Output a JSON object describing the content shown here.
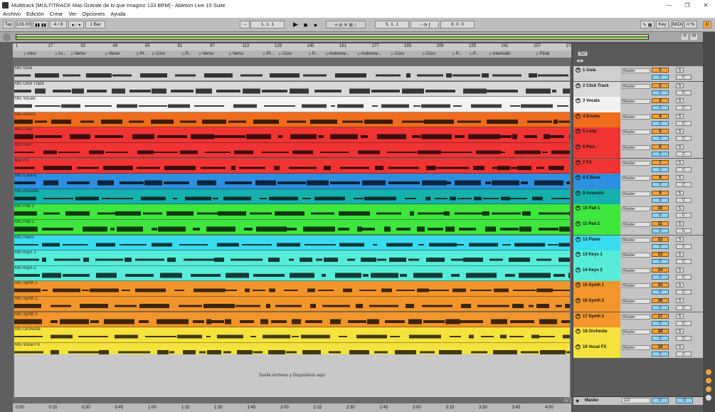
{
  "window": {
    "title": "Multitrack  [MULTITRACK Mas Grande de lo que Imagino 133 BPM]  - Ableton Live 10 Suite",
    "controls": [
      "—",
      "❐",
      "✕"
    ]
  },
  "menu": [
    "Archivo",
    "Edición",
    "Crear",
    "Ver",
    "Opciones",
    "Ayuda"
  ],
  "transport": {
    "tap": "Tap",
    "tempo": "133.00",
    "signature": "4 / 8",
    "metronome": "1 Bar",
    "position": "1.  1.  1",
    "loop_start": "5.  1.  1",
    "loop_length": "8.  0.  0",
    "key": "Key",
    "midi": "MIDI",
    "cpu": "0 %",
    "d": "D"
  },
  "ruler": [
    "1",
    "17",
    "33",
    "49",
    "65",
    "81",
    "97",
    "113",
    "129",
    "145",
    "161",
    "177",
    "193",
    "209",
    "225",
    "241",
    "257",
    "273"
  ],
  "locators": [
    "Intro",
    "In...",
    "Verso",
    "Verso",
    "Pr...",
    "Coro",
    "P...",
    "Verso",
    "Verso",
    "Pr...",
    "Coro",
    "P...",
    "Instrume...",
    "Instrume...",
    "Coro",
    "Coro",
    "P...",
    "P...",
    "Interludio",
    "Final"
  ],
  "set_label": "Set",
  "drop_hint": "Suelte Archivos y Dispositivos aquí",
  "time_axis": [
    "0:00",
    "0:15",
    "0:30",
    "0:45",
    "1:00",
    "1:15",
    "1:30",
    "1:45",
    "2:00",
    "2:15",
    "2:30",
    "2:45",
    "3:00",
    "3:15",
    "3:30",
    "3:45",
    "4:00"
  ],
  "page_indicator": "4/1",
  "tracks": [
    {
      "clip": "MG Guia",
      "name": "1 Guia",
      "num": "1",
      "routing": "Master",
      "color": "#cfcfcf"
    },
    {
      "clip": "MG Click Track",
      "name": "2 Click Track",
      "num": "2",
      "routing": "Master",
      "color": "#d9d9d9"
    },
    {
      "clip": "MG Vocals",
      "name": "3 Vocals",
      "num": "3",
      "routing": "Master",
      "color": "#f2f2f2"
    },
    {
      "clip": "MG Drums",
      "name": "4 Drums",
      "num": "4",
      "routing": "Master",
      "color": "#ee6c1c"
    },
    {
      "clip": "MG Loop",
      "name": "5 Loop",
      "num": "5",
      "routing": "Master",
      "color": "#f03434"
    },
    {
      "clip": "MG Perc",
      "name": "6 Perc",
      "num": "6",
      "routing": "Master",
      "color": "#f03434"
    },
    {
      "clip": "MG FX",
      "name": "7 FX",
      "num": "7",
      "routing": "Master",
      "color": "#f03434"
    },
    {
      "clip": "MG E.Bass",
      "name": "8 E.Bass",
      "num": "8",
      "routing": "Master",
      "color": "#2d8fdf"
    },
    {
      "clip": "MG Acoustic",
      "name": "9 Acoustic",
      "num": "9",
      "routing": "Master",
      "color": "#16b1ad"
    },
    {
      "clip": "MG Pad 1",
      "name": "10 Pad 1",
      "num": "10",
      "routing": "Master",
      "color": "#3ee63e"
    },
    {
      "clip": "MG Pad 2",
      "name": "11 Pad 2",
      "num": "11",
      "routing": "Master",
      "color": "#3ee63e"
    },
    {
      "clip": "MG Piano",
      "name": "12 Piano",
      "num": "12",
      "routing": "Master",
      "color": "#39dcee"
    },
    {
      "clip": "MG Keys 1",
      "name": "13 Keys 1",
      "num": "13",
      "routing": "Master",
      "color": "#56ecd8"
    },
    {
      "clip": "MG Keys 2",
      "name": "14 Keys 2",
      "num": "14",
      "routing": "Master",
      "color": "#56ecd8"
    },
    {
      "clip": "MG Synth 1",
      "name": "15 Synth 1",
      "num": "15",
      "routing": "Master",
      "color": "#f2952a"
    },
    {
      "clip": "MG Synth 2",
      "name": "16 Synth 2",
      "num": "16",
      "routing": "Master",
      "color": "#f2952a"
    },
    {
      "clip": "MG Synth 3",
      "name": "17 Synth 3",
      "num": "17",
      "routing": "Master",
      "color": "#f2952a"
    },
    {
      "clip": "MG Orchesta",
      "name": "18 Orchesta",
      "num": "18",
      "routing": "Master",
      "color": "#f5e23c"
    },
    {
      "clip": "MG Vocal FX",
      "name": "19 Vocal FX",
      "num": "19",
      "routing": "Master",
      "color": "#f5e23c"
    }
  ],
  "volume": "0",
  "solo": "S",
  "cue": "C",
  "master": {
    "name": "Master",
    "routing": "1/2",
    "vol": "0",
    "pan": "0"
  }
}
